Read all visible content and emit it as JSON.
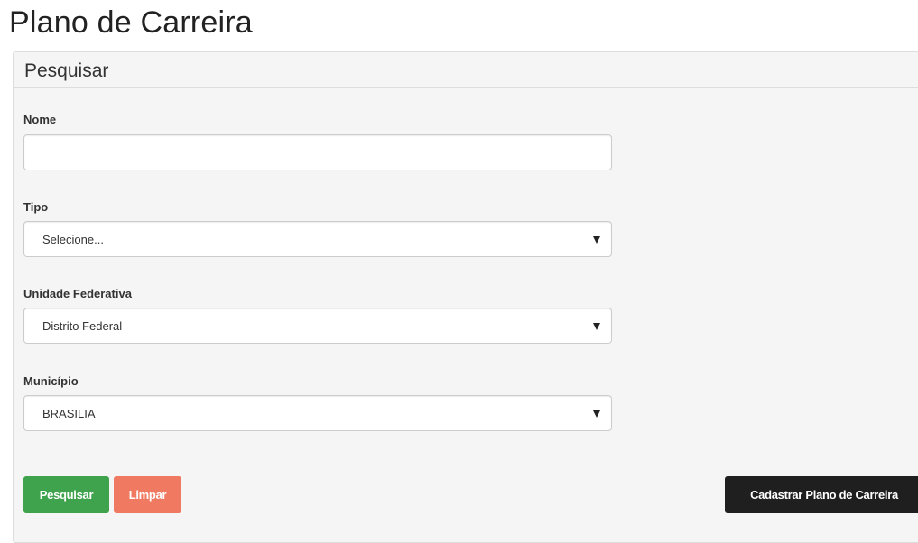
{
  "page": {
    "title": "Plano de Carreira"
  },
  "panel": {
    "heading": "Pesquisar"
  },
  "form": {
    "nome": {
      "label": "Nome",
      "value": "",
      "placeholder": ""
    },
    "tipo": {
      "label": "Tipo",
      "selected": "Selecione..."
    },
    "uf": {
      "label": "Unidade Federativa",
      "selected": "Distrito Federal"
    },
    "municipio": {
      "label": "Município",
      "selected": "BRASILIA"
    }
  },
  "buttons": {
    "search": "Pesquisar",
    "clear": "Limpar",
    "create": "Cadastrar Plano de Carreira"
  },
  "colors": {
    "search_button": "#3fa34d",
    "clear_button": "#f07a61",
    "create_button": "#1f1f1f",
    "panel_background": "#f5f5f5"
  },
  "icons": {
    "select_caret": "caret-down-icon"
  }
}
